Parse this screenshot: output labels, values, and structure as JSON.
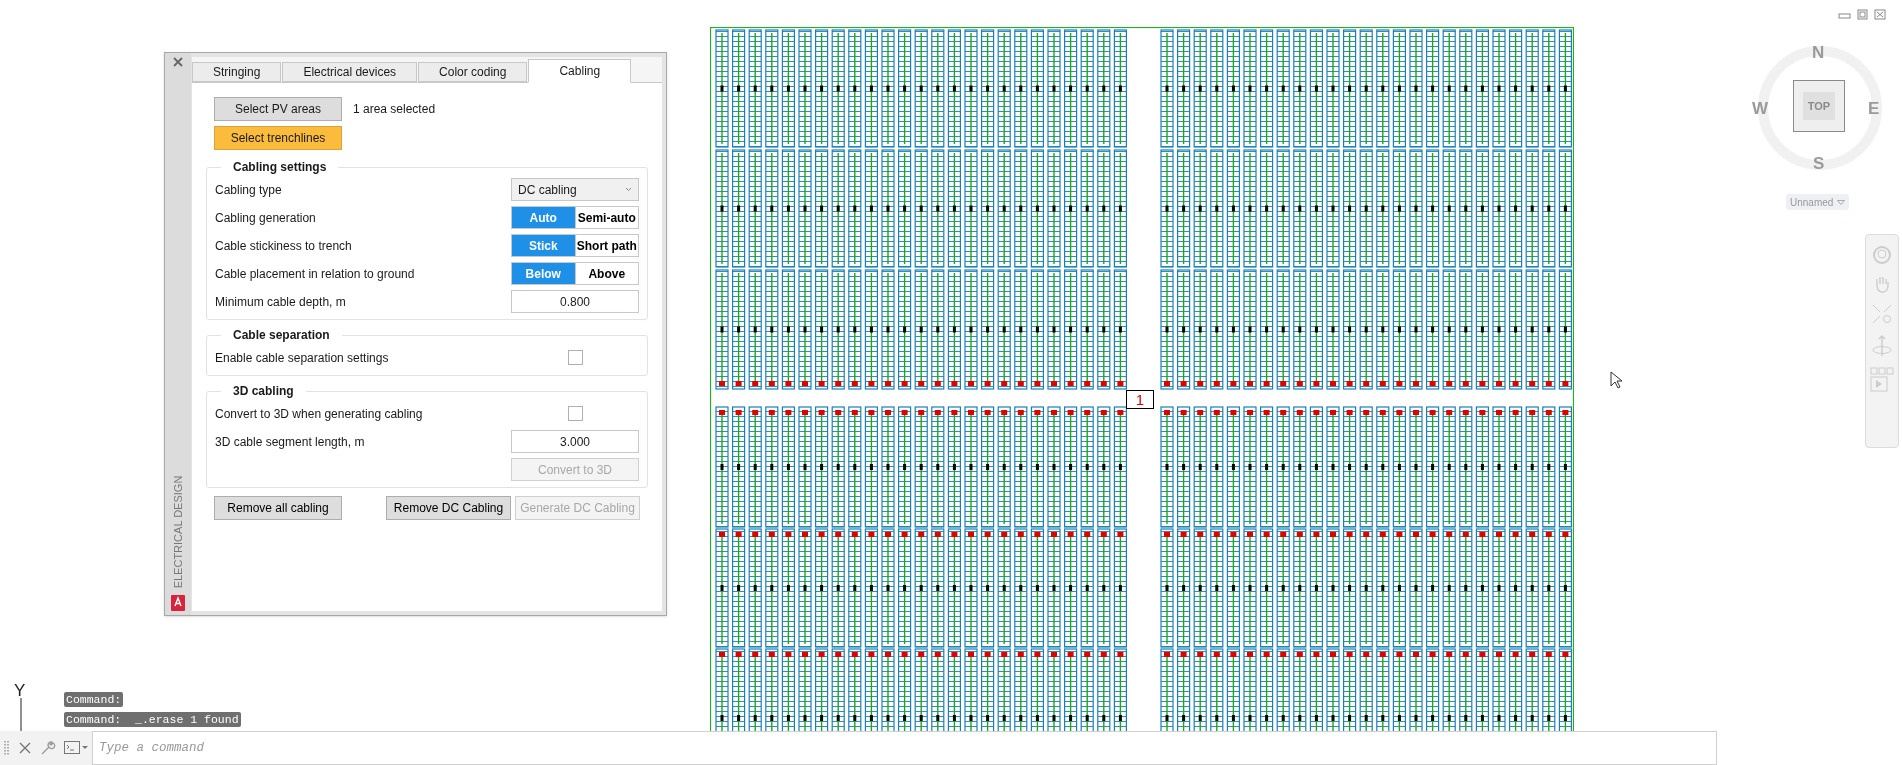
{
  "palette": {
    "side_title": "ELECTRICAL DESIGN",
    "tabs": [
      {
        "label": "Stringing",
        "selected": false
      },
      {
        "label": "Electrical devices",
        "selected": false
      },
      {
        "label": "Color coding",
        "selected": false
      },
      {
        "label": "Cabling",
        "selected": true
      }
    ],
    "selection_buttons": [
      {
        "label": "Select PV areas",
        "active": false,
        "status": "1 area selected"
      },
      {
        "label": "Select trenchlines",
        "active": true
      }
    ],
    "groups": [
      {
        "title": "Cabling settings",
        "rows": [
          {
            "kind": "dropdown",
            "label": "Cabling type",
            "value": "DC cabling"
          },
          {
            "kind": "toggle",
            "label": "Cabling generation",
            "options": [
              {
                "label": "Auto",
                "selected": true
              },
              {
                "label": "Semi-auto",
                "selected": false
              }
            ]
          },
          {
            "kind": "toggle",
            "label": "Cable stickiness to trench",
            "options": [
              {
                "label": "Stick",
                "selected": true
              },
              {
                "label": "Short path",
                "selected": false
              }
            ]
          },
          {
            "kind": "toggle",
            "label": "Cable placement in relation to ground",
            "options": [
              {
                "label": "Below",
                "selected": true
              },
              {
                "label": "Above",
                "selected": false
              }
            ]
          },
          {
            "kind": "number",
            "label": "Minimum cable depth, m",
            "value": "0.800"
          }
        ]
      },
      {
        "title": "Cable separation",
        "rows": [
          {
            "kind": "checkbox",
            "label": "Enable cable separation settings",
            "checked": false
          }
        ]
      },
      {
        "title": "3D cabling",
        "rows": [
          {
            "kind": "checkbox",
            "label": "Convert to 3D when generating cabling",
            "checked": false
          },
          {
            "kind": "number",
            "label": "3D cable segment length, m",
            "value": "3.000"
          },
          {
            "kind": "button",
            "label": "Convert to 3D",
            "disabled": true
          }
        ]
      }
    ],
    "buttons": [
      {
        "label": "Remove all cabling",
        "disabled": false
      },
      {
        "label": "Remove DC Cabling",
        "disabled": false
      },
      {
        "label": "Generate DC Cabling",
        "disabled": true
      }
    ]
  },
  "drawing": {
    "area_label": "1"
  },
  "viewcube": {
    "north": "N",
    "west": "W",
    "east": "E",
    "south": "S",
    "face": "TOP",
    "ucs_menu": "Unnamed"
  },
  "ucs_icon": {
    "axis": "Y"
  },
  "command_history": [
    "Command:",
    "Command:  _.erase 1 found"
  ],
  "command_line": {
    "placeholder": "Type a command"
  }
}
